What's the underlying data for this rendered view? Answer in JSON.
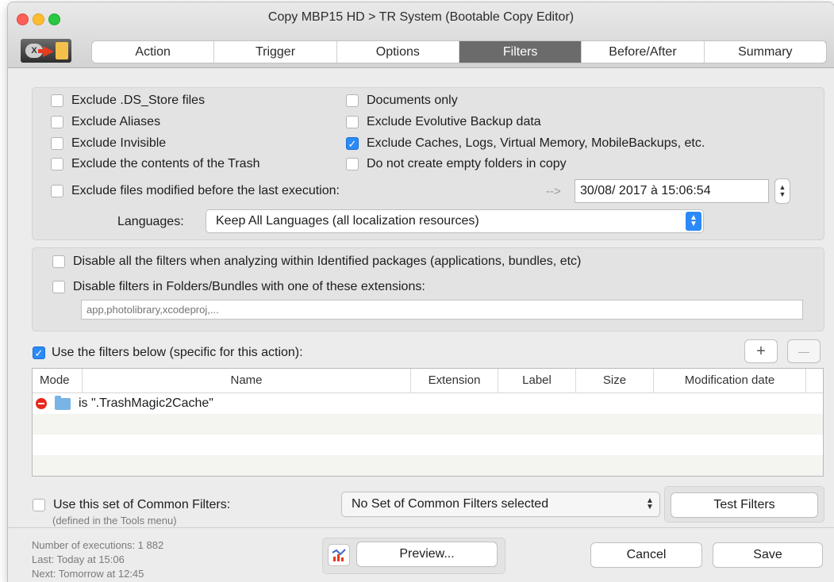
{
  "window": {
    "title": "Copy MBP15 HD > TR System (Bootable Copy Editor)"
  },
  "tabs": [
    {
      "label": "Action",
      "active": false
    },
    {
      "label": "Trigger",
      "active": false
    },
    {
      "label": "Options",
      "active": false
    },
    {
      "label": "Filters",
      "active": true
    },
    {
      "label": "Before/After",
      "active": false
    },
    {
      "label": "Summary",
      "active": false
    }
  ],
  "filters": {
    "exclude_ds_store": {
      "label": "Exclude .DS_Store files",
      "checked": false
    },
    "exclude_aliases": {
      "label": "Exclude Aliases",
      "checked": false
    },
    "exclude_invisible": {
      "label": "Exclude Invisible",
      "checked": false
    },
    "exclude_trash": {
      "label": "Exclude the contents of the Trash",
      "checked": false
    },
    "documents_only": {
      "label": "Documents only",
      "checked": false
    },
    "exclude_evolutive": {
      "label": "Exclude Evolutive Backup data",
      "checked": false
    },
    "exclude_caches": {
      "label": "Exclude Caches, Logs, Virtual Memory, MobileBackups, etc.",
      "checked": true
    },
    "no_empty_folders": {
      "label": "Do not create empty folders in copy",
      "checked": false
    },
    "exclude_modified": {
      "label": "Exclude files modified before the last execution:",
      "checked": false
    },
    "arrow": "-->",
    "date_value": "30/08/ 2017 à 15:06:54",
    "languages_label": "Languages:",
    "languages_value": "Keep All Languages (all localization resources)"
  },
  "packages": {
    "disable_identified": {
      "label": "Disable all the filters when analyzing within Identified packages (applications, bundles, etc)",
      "checked": false
    },
    "disable_extensions": {
      "label": "Disable filters in Folders/Bundles with one of these extensions:",
      "checked": false
    },
    "extensions_placeholder": "app,photolibrary,xcodeproj,..."
  },
  "specific": {
    "use_filters": {
      "label": "Use the filters below (specific for this action):",
      "checked": true
    },
    "add_label": "+",
    "remove_label": "—",
    "columns": [
      "Mode",
      "Name",
      "Extension",
      "Label",
      "Size",
      "Modification date"
    ],
    "rows": [
      {
        "mode": "exclude",
        "text": "is \".TrashMagic2Cache\""
      }
    ]
  },
  "common": {
    "use_common": {
      "label": "Use this set of Common Filters:",
      "checked": false
    },
    "note": "(defined in the Tools menu)",
    "set_value": "No Set of Common Filters selected",
    "test_button": "Test Filters"
  },
  "footer": {
    "executions": "Number of executions: 1 882",
    "last": "Last: Today at 15:06",
    "next": "Next: Tomorrow at 12:45",
    "preview_button": "Preview...",
    "cancel_button": "Cancel",
    "save_button": "Save"
  },
  "colors": {
    "accent": "#2b8af7",
    "active_tab": "#6b6b6b",
    "exclude_red": "#e8281d"
  }
}
